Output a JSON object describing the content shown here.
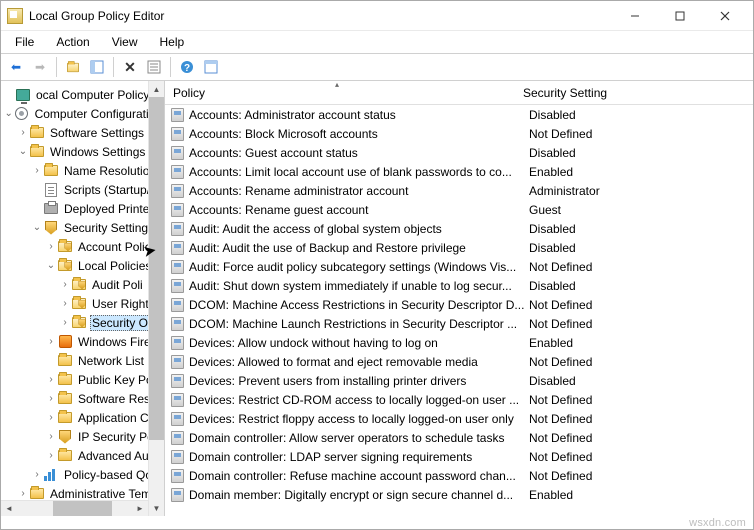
{
  "window": {
    "title": "Local Group Policy Editor"
  },
  "menu": {
    "items": [
      "File",
      "Action",
      "View",
      "Help"
    ]
  },
  "toolbar": {
    "buttons": [
      {
        "name": "back-icon",
        "glyph": "◄",
        "color": "#1e6fd6"
      },
      {
        "name": "forward-icon",
        "glyph": "►",
        "color": "#b8b8b8"
      },
      {
        "name": "up-icon",
        "glyph": "folder-up"
      },
      {
        "name": "sep"
      },
      {
        "name": "show-hide-tree-icon",
        "glyph": "tree"
      },
      {
        "name": "delete-icon",
        "glyph": "✖",
        "color": "#333"
      },
      {
        "name": "export-icon",
        "glyph": "list"
      },
      {
        "name": "sep"
      },
      {
        "name": "help-icon",
        "glyph": "?",
        "color": "#1e6fd6"
      },
      {
        "name": "properties-icon",
        "glyph": "tree"
      }
    ]
  },
  "tree": {
    "nodes": [
      {
        "depth": 0,
        "tw": "",
        "icon": "pc",
        "label": "ocal Computer Policy"
      },
      {
        "depth": 0,
        "tw": "v",
        "icon": "gear",
        "label": "Computer Configuration"
      },
      {
        "depth": 1,
        "tw": ">",
        "icon": "folder",
        "label": "Software Settings"
      },
      {
        "depth": 1,
        "tw": "v",
        "icon": "folder",
        "label": "Windows Settings"
      },
      {
        "depth": 2,
        "tw": ">",
        "icon": "folder",
        "label": "Name Resolution"
      },
      {
        "depth": 2,
        "tw": "",
        "icon": "scroll",
        "label": "Scripts (Startup/S"
      },
      {
        "depth": 2,
        "tw": "",
        "icon": "printer",
        "label": "Deployed Printer"
      },
      {
        "depth": 2,
        "tw": "v",
        "icon": "shield",
        "label": "Security Settings"
      },
      {
        "depth": 3,
        "tw": ">",
        "icon": "shield-f",
        "label": "Account Polici"
      },
      {
        "depth": 3,
        "tw": "v",
        "icon": "shield-f",
        "label": "Local Policies"
      },
      {
        "depth": 4,
        "tw": ">",
        "icon": "shield-f",
        "label": "Audit Poli"
      },
      {
        "depth": 4,
        "tw": ">",
        "icon": "shield-f",
        "label": "User Right"
      },
      {
        "depth": 4,
        "tw": ">",
        "icon": "shield-f",
        "label": "Security O",
        "selected": true
      },
      {
        "depth": 3,
        "tw": ">",
        "icon": "fire",
        "label": "Windows Fire"
      },
      {
        "depth": 3,
        "tw": "",
        "icon": "folder",
        "label": "Network List"
      },
      {
        "depth": 3,
        "tw": ">",
        "icon": "folder",
        "label": "Public Key Po"
      },
      {
        "depth": 3,
        "tw": ">",
        "icon": "folder",
        "label": "Software Rest"
      },
      {
        "depth": 3,
        "tw": ">",
        "icon": "folder",
        "label": "Application C"
      },
      {
        "depth": 3,
        "tw": ">",
        "icon": "shield",
        "label": "IP Security Pc"
      },
      {
        "depth": 3,
        "tw": ">",
        "icon": "folder",
        "label": "Advanced Au"
      },
      {
        "depth": 2,
        "tw": ">",
        "icon": "bars",
        "label": "Policy-based QoS"
      },
      {
        "depth": 1,
        "tw": ">",
        "icon": "folder",
        "label": "Administrative Temp"
      }
    ]
  },
  "list": {
    "columns": [
      "Policy",
      "Security Setting"
    ],
    "rows": [
      {
        "name": "Accounts: Administrator account status",
        "value": "Disabled"
      },
      {
        "name": "Accounts: Block Microsoft accounts",
        "value": "Not Defined"
      },
      {
        "name": "Accounts: Guest account status",
        "value": "Disabled"
      },
      {
        "name": "Accounts: Limit local account use of blank passwords to co...",
        "value": "Enabled"
      },
      {
        "name": "Accounts: Rename administrator account",
        "value": "Administrator"
      },
      {
        "name": "Accounts: Rename guest account",
        "value": "Guest"
      },
      {
        "name": "Audit: Audit the access of global system objects",
        "value": "Disabled"
      },
      {
        "name": "Audit: Audit the use of Backup and Restore privilege",
        "value": "Disabled"
      },
      {
        "name": "Audit: Force audit policy subcategory settings (Windows Vis...",
        "value": "Not Defined"
      },
      {
        "name": "Audit: Shut down system immediately if unable to log secur...",
        "value": "Disabled"
      },
      {
        "name": "DCOM: Machine Access Restrictions in Security Descriptor D...",
        "value": "Not Defined"
      },
      {
        "name": "DCOM: Machine Launch Restrictions in Security Descriptor ...",
        "value": "Not Defined"
      },
      {
        "name": "Devices: Allow undock without having to log on",
        "value": "Enabled"
      },
      {
        "name": "Devices: Allowed to format and eject removable media",
        "value": "Not Defined"
      },
      {
        "name": "Devices: Prevent users from installing printer drivers",
        "value": "Disabled"
      },
      {
        "name": "Devices: Restrict CD-ROM access to locally logged-on user ...",
        "value": "Not Defined"
      },
      {
        "name": "Devices: Restrict floppy access to locally logged-on user only",
        "value": "Not Defined"
      },
      {
        "name": "Domain controller: Allow server operators to schedule tasks",
        "value": "Not Defined"
      },
      {
        "name": "Domain controller: LDAP server signing requirements",
        "value": "Not Defined"
      },
      {
        "name": "Domain controller: Refuse machine account password chan...",
        "value": "Not Defined"
      },
      {
        "name": "Domain member: Digitally encrypt or sign secure channel d...",
        "value": "Enabled"
      }
    ]
  },
  "watermark": "wsxdn.com"
}
